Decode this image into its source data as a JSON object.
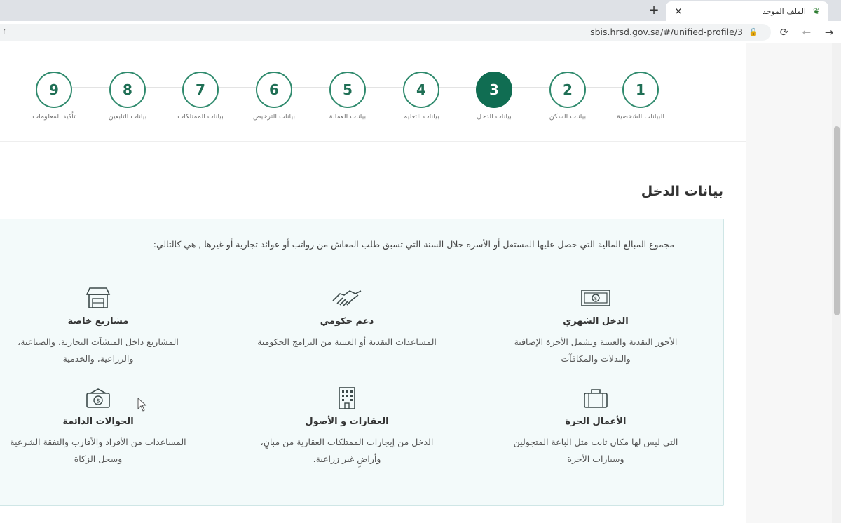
{
  "browser": {
    "tab_title": "الملف الموحد",
    "tab_close": "×",
    "new_tab": "+",
    "url": "sbis.hrsd.gov.sa/#/unified-profile/3",
    "omnibox_left_text": "r"
  },
  "steps": [
    {
      "number": "1",
      "label": "البيانات الشخصية"
    },
    {
      "number": "2",
      "label": "بيانات السكن"
    },
    {
      "number": "3",
      "label": "بيانات الدخل",
      "active": true
    },
    {
      "number": "4",
      "label": "بيانات التعليم"
    },
    {
      "number": "5",
      "label": "بيانات العمالة"
    },
    {
      "number": "6",
      "label": "بيانات الترخيص"
    },
    {
      "number": "7",
      "label": "بيانات الممتلكات"
    },
    {
      "number": "8",
      "label": "بيانات التابعين"
    },
    {
      "number": "9",
      "label": "تأكيد المعلومات"
    }
  ],
  "section": {
    "title": "بيانات الدخل",
    "intro": "مجموع المبالغ المالية التي حصل عليها المستقل أو الأسرة خلال السنة التي تسبق طلب المعاش من رواتب أو عوائد تجارية أو غيرها , هي كالتالي:"
  },
  "income_types": [
    {
      "icon": "cash-icon",
      "title": "الدخل الشهري",
      "line1": "الأجور النقدية والعينية وتشمل الأجرة الإضافية",
      "line2": "والبدلات والمكافآت"
    },
    {
      "icon": "handshake-icon",
      "title": "دعم حكومي",
      "line1": "المساعدات النقدية أو العينية من البرامج الحكومية",
      "line2": ""
    },
    {
      "icon": "store-icon",
      "title": "مشاريع خاصة",
      "line1": "المشاريع داخل المنشآت التجارية، والصناعية،",
      "line2": "والزراعية، والخدمية"
    },
    {
      "icon": "briefcase-icon",
      "title": "الأعمال الحرة",
      "line1": "التي ليس لها مكان ثابت مثل الباعة المتجولين",
      "line2": "وسيارات الأجرة"
    },
    {
      "icon": "building-icon",
      "title": "العقارات و الأصول",
      "line1": "الدخل من إيجارات الممتلكات العقارية من مبانٍ،",
      "line2": "وأراضٍ غير زراعية."
    },
    {
      "icon": "money-transfer-icon",
      "title": "الحوالات الدائمة",
      "line1": "المساعدات من الأفراد والأقارب والنفقة الشرعية",
      "line2": "وسجل الزكاة"
    }
  ],
  "colors": {
    "primary": "#106d52",
    "step_border": "#2f8a6d",
    "box_bg": "#f3fafa",
    "box_border": "#cfe6e6"
  }
}
